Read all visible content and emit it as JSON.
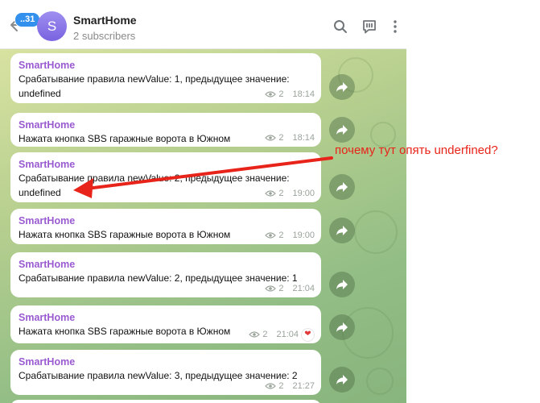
{
  "header": {
    "unread_count": "..31",
    "avatar_letter": "S",
    "title": "SmartHome",
    "subtitle": "2 subscribers",
    "icons": [
      "back-arrow-icon",
      "search-icon",
      "comments-icon",
      "more-vertical-icon"
    ]
  },
  "messages": [
    {
      "sender": "SmartHome",
      "text": "Срабатывание правила newValue: 1, предыдущее значение: undefined",
      "views": "2",
      "time": "18:14"
    },
    {
      "sender": "SmartHome",
      "text": "Нажата кнопка SBS гаражные ворота в Южном",
      "views": "2",
      "time": "18:14"
    },
    {
      "sender": "SmartHome",
      "text": "Срабатывание правила newValue: 2, предыдущее значение: undefined",
      "views": "2",
      "time": "19:00"
    },
    {
      "sender": "SmartHome",
      "text": "Нажата кнопка SBS гаражные ворота в Южном",
      "views": "2",
      "time": "19:00"
    },
    {
      "sender": "SmartHome",
      "text": "Срабатывание правила newValue: 2, предыдущее значение: 1",
      "views": "2",
      "time": "21:04"
    },
    {
      "sender": "SmartHome",
      "text": "Нажата кнопка SBS гаражные ворота в Южном",
      "views": "2",
      "time": "21:04",
      "reaction": "heart"
    },
    {
      "sender": "SmartHome",
      "text": "Срабатывание правила newValue: 3, предыдущее значение: 2",
      "views": "2",
      "time": "21:27"
    }
  ],
  "annotation": {
    "text": "почему тут опять underfined?",
    "color": "#e8231a"
  },
  "colors": {
    "accent": "#3390ec",
    "sender": "#9a5bd1",
    "annotation": "#e8231a"
  }
}
